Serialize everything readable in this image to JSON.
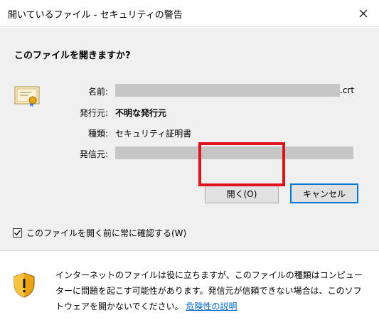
{
  "window": {
    "title": "開いているファイル - セキュリティの警告",
    "close_icon": "close-icon"
  },
  "dialog": {
    "question": "このファイルを開きますか?",
    "fields": {
      "name_label": "名前:",
      "name_suffix": ".crt",
      "publisher_label": "発行元:",
      "publisher_value": "不明な発行元",
      "type_label": "種類:",
      "type_value": "セキュリティ証明書",
      "from_label": "発信元:"
    },
    "buttons": {
      "open": "開く(O)",
      "cancel": "キャンセル"
    },
    "checkbox": {
      "label": "このファイルを開く前に常に確認する(W)",
      "checked": true
    }
  },
  "footer": {
    "warning_text": "インターネットのファイルは役に立ちますが、このファイルの種類はコンピューターに問題を起こす可能性があります。発信元が信頼できない場合は、このソフトウェアを開かないでください。",
    "link_text": "危険性の説明",
    "icon": "shield-warning-icon"
  },
  "colors": {
    "highlight": "#e0121c",
    "accent": "#0078d7",
    "link": "#0066cc"
  }
}
